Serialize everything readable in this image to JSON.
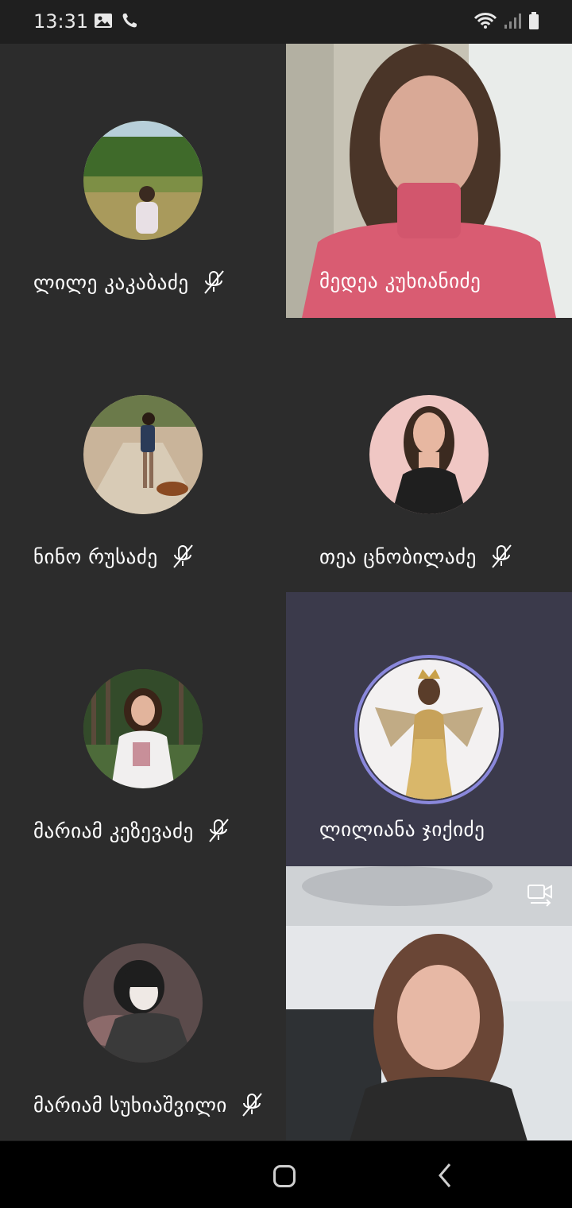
{
  "status_bar": {
    "time": "13:31",
    "left_icons": [
      "image-icon",
      "phone-icon"
    ],
    "right_icons": [
      "wifi-icon",
      "signal-icon",
      "battery-icon"
    ]
  },
  "participants": [
    {
      "name": "ლილე კაკაბაძე",
      "muted": true,
      "type": "avatar"
    },
    {
      "name": "მედეა კუხიანიძე",
      "muted": false,
      "type": "video"
    },
    {
      "name": "ნინო რუსაძე",
      "muted": true,
      "type": "avatar"
    },
    {
      "name": "თეა ცნობილაძე",
      "muted": true,
      "type": "avatar"
    },
    {
      "name": "მარიამ კეზევაძე",
      "muted": true,
      "type": "avatar"
    },
    {
      "name": "ლილიანა ჯიქიძე",
      "muted": false,
      "type": "avatar",
      "speaking": true
    },
    {
      "name": "მარიამ სუხიაშვილი",
      "muted": true,
      "type": "avatar"
    },
    {
      "name": "",
      "muted": false,
      "type": "video",
      "self": true
    }
  ],
  "colors": {
    "tile_bg": "#2c2c2c",
    "active_tile_bg": "#3b3a4b",
    "speaking_ring": "#8a88dc",
    "nav_bar": "#000000"
  },
  "nav_bar": {
    "home": "home-icon",
    "back": "back-icon"
  }
}
